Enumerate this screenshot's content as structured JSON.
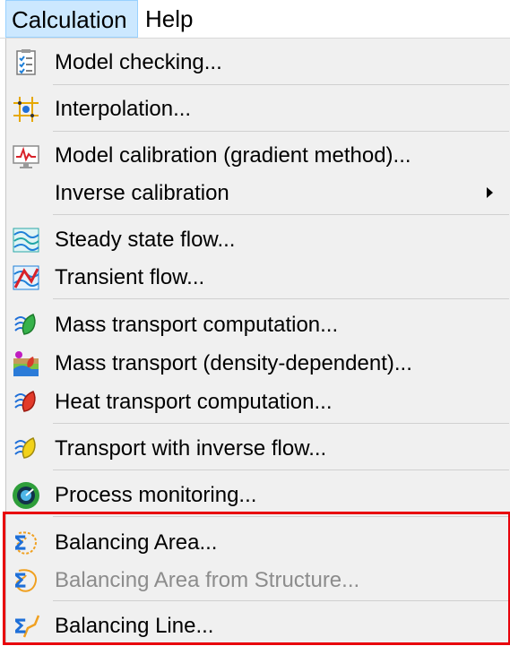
{
  "menubar": {
    "items": [
      {
        "label": "Calculation"
      },
      {
        "label": "Help"
      }
    ]
  },
  "menu": {
    "items": [
      {
        "label": "Model checking...",
        "icon": "checklist-icon"
      },
      {
        "label": "Interpolation...",
        "icon": "interpolation-grid-icon"
      },
      {
        "label": "Model calibration (gradient method)...",
        "icon": "calibration-monitor-icon"
      },
      {
        "label": "Inverse calibration",
        "icon": "",
        "submenu": true
      },
      {
        "label": "Steady state flow...",
        "icon": "steady-flow-icon"
      },
      {
        "label": "Transient flow...",
        "icon": "transient-flow-icon"
      },
      {
        "label": "Mass transport computation...",
        "icon": "mass-transport-icon"
      },
      {
        "label": "Mass transport (density-dependent)...",
        "icon": "density-transport-icon"
      },
      {
        "label": "Heat transport computation...",
        "icon": "heat-transport-icon"
      },
      {
        "label": "Transport with inverse flow...",
        "icon": "inverse-flow-transport-icon"
      },
      {
        "label": "Process monitoring...",
        "icon": "process-monitoring-icon"
      },
      {
        "label": "Balancing Area...",
        "icon": "balancing-area-icon"
      },
      {
        "label": "Balancing Area from Structure...",
        "icon": "balancing-area-structure-icon",
        "disabled": true
      },
      {
        "label": "Balancing Line...",
        "icon": "balancing-line-icon"
      }
    ]
  },
  "colors": {
    "highlight_box": "#e8000b",
    "active_menu": "#cce8ff",
    "menu_background": "#f0f0f0",
    "disabled_text": "#8c8c8c"
  }
}
